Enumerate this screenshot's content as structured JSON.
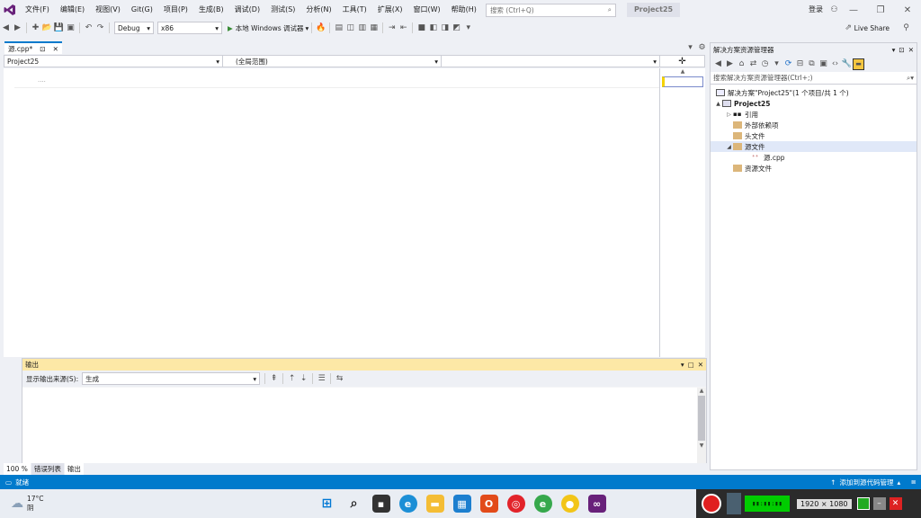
{
  "menubar": {
    "items": [
      "文件(F)",
      "编辑(E)",
      "视图(V)",
      "Git(G)",
      "项目(P)",
      "生成(B)",
      "调试(D)",
      "测试(S)",
      "分析(N)",
      "工具(T)",
      "扩展(X)",
      "窗口(W)",
      "帮助(H)"
    ],
    "search_placeholder": "搜索 (Ctrl+Q)",
    "project_title": "Project25",
    "login": "登录",
    "live_share": "Live Share"
  },
  "toolbar": {
    "config": "Debug",
    "platform": "x86",
    "run_label": "本地 Windows 调试器"
  },
  "editor": {
    "tab_label": "源.cpp*",
    "nav_project": "Project25",
    "nav_scope": "(全局范围)",
    "nav_member": "",
    "code_placeholder": "....",
    "zoom": "100 %"
  },
  "output": {
    "title": "输出",
    "source_label": "显示输出来源(S):",
    "source_value": "生成"
  },
  "bottom_tabs": [
    "错误列表",
    "输出"
  ],
  "solution_explorer": {
    "title": "解决方案资源管理器",
    "search_placeholder": "搜索解决方案资源管理器(Ctrl+;)",
    "tree": [
      {
        "label": "解决方案\"Project25\"(1 个项目/共 1 个)",
        "level": 0,
        "caret": ""
      },
      {
        "label": "Project25",
        "level": 0,
        "caret": "▲"
      },
      {
        "label": "引用",
        "level": 1,
        "caret": "▷"
      },
      {
        "label": "外部依赖项",
        "level": 1,
        "caret": ""
      },
      {
        "label": "头文件",
        "level": 1,
        "caret": ""
      },
      {
        "label": "源文件",
        "level": 1,
        "caret": "◢"
      },
      {
        "label": "源.cpp",
        "level": 2,
        "caret": ""
      },
      {
        "label": "资源文件",
        "level": 1,
        "caret": ""
      }
    ]
  },
  "statusbar": {
    "ready": "就绪",
    "source_control": "添加到源代码管理"
  },
  "taskbar": {
    "weather_temp": "17°C",
    "weather_desc": "阴",
    "resolution": "1920 × 1080"
  },
  "colors": {
    "accent": "#007acc",
    "vs_purple": "#68217a",
    "output_header": "#fde8a6"
  }
}
